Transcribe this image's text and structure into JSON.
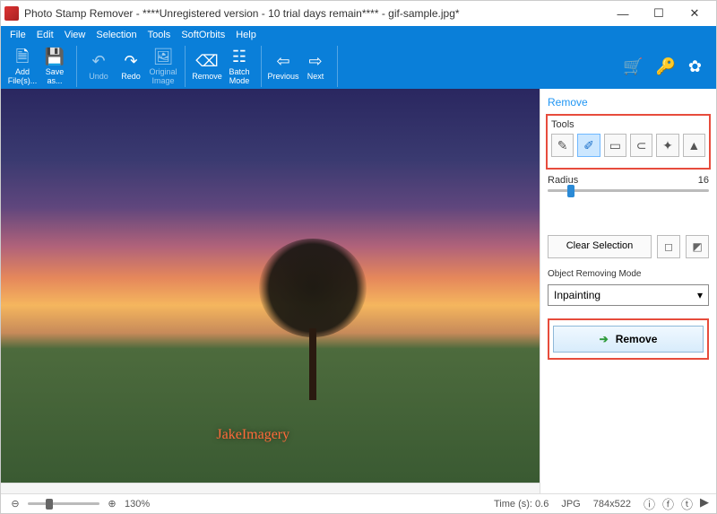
{
  "window": {
    "title": "Photo Stamp Remover - ****Unregistered version - 10 trial days remain**** - gif-sample.jpg*"
  },
  "menu": {
    "file": "File",
    "edit": "Edit",
    "view": "View",
    "selection": "Selection",
    "tools": "Tools",
    "softorbits": "SoftOrbits",
    "help": "Help"
  },
  "toolbar": {
    "add_files": "Add File(s)...",
    "save_as": "Save as...",
    "undo": "Undo",
    "redo": "Redo",
    "original_image": "Original Image",
    "remove": "Remove",
    "batch_mode": "Batch Mode",
    "previous": "Previous",
    "next": "Next"
  },
  "panel": {
    "header": "Remove",
    "tools_label": "Tools",
    "radius_label": "Radius",
    "radius_value": "16",
    "clear_selection": "Clear Selection",
    "mode_label": "Object Removing Mode",
    "mode_value": "Inpainting",
    "remove_btn": "Remove"
  },
  "watermark": "JakeImagery",
  "status": {
    "zoom": "130%",
    "time": "Time (s): 0.6",
    "format": "JPG",
    "dimensions": "784x522"
  }
}
